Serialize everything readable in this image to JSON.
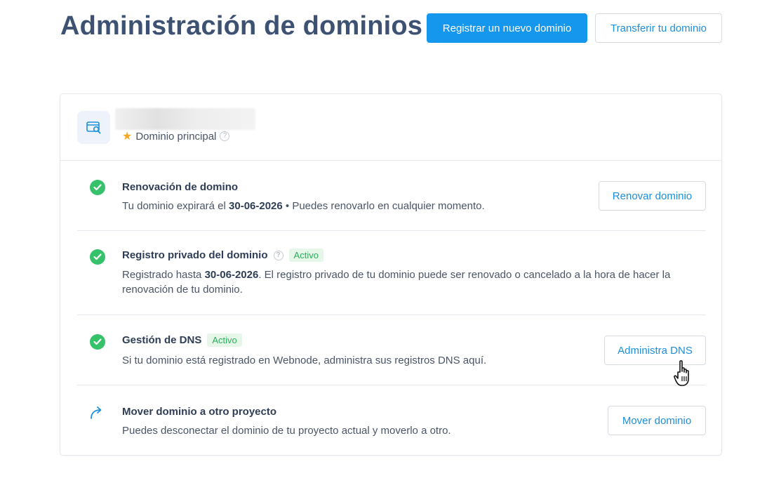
{
  "header": {
    "title": "Administración de dominios",
    "register_label": "Registrar un nuevo dominio",
    "transfer_label": "Transferir tu dominio"
  },
  "domain": {
    "primary_label": "Dominio principal",
    "help_glyph": "?"
  },
  "rows": [
    {
      "title": "Renovación de domino",
      "desc_prefix": "Tu dominio expirará el ",
      "desc_date": "30-06-2026",
      "desc_suffix": " • Puedes renovarlo en cualquier momento.",
      "button": "Renovar dominio",
      "status_icon": "check-circle-icon"
    },
    {
      "title": "Registro privado del dominio",
      "badge": "Activo",
      "desc_prefix": "Registrado hasta ",
      "desc_date": "30-06-2026",
      "desc_suffix": ". El registro privado de tu dominio puede ser renovado o cancelado a la hora de hacer la renovación de tu dominio.",
      "status_icon": "check-circle-icon"
    },
    {
      "title": "Gestión de DNS",
      "badge": "Activo",
      "desc": "Si tu dominio está registrado en Webnode, administra sus registros DNS aquí.",
      "button": "Administra DNS",
      "status_icon": "check-circle-icon"
    },
    {
      "title": "Mover dominio a otro proyecto",
      "desc": "Puedes desconectar el dominio de tu proyecto actual y moverlo a otro.",
      "button": "Mover dominio",
      "status_icon": "share-arrow-icon"
    }
  ],
  "colors": {
    "primary": "#1697ee",
    "success": "#36c26b",
    "title": "#3d5273"
  }
}
